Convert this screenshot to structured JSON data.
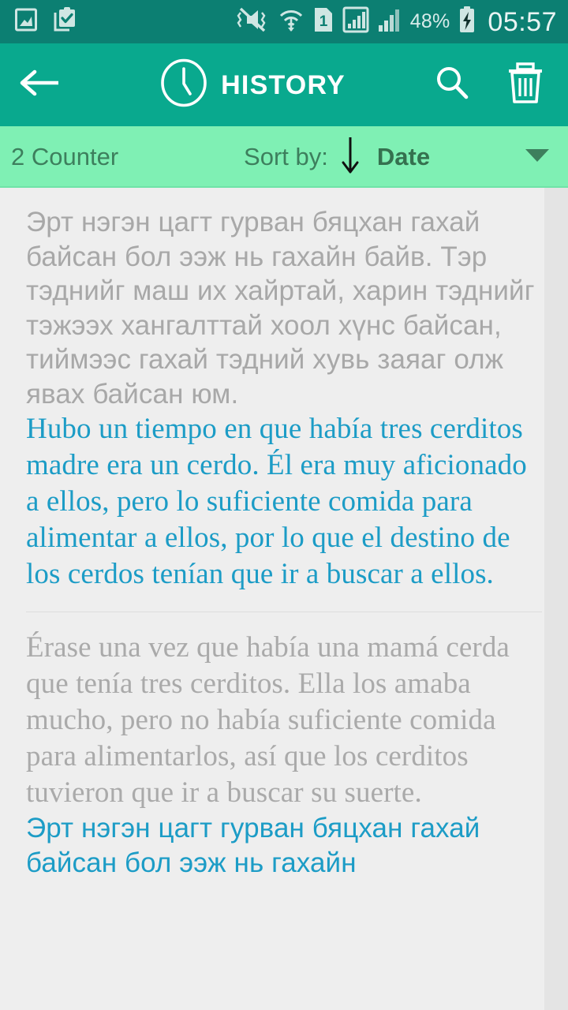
{
  "statusbar": {
    "left_icons": [
      {
        "name": "image-icon"
      },
      {
        "name": "clipboard-check-icon"
      }
    ],
    "right_icons": [
      {
        "name": "mute-vibrate-icon"
      },
      {
        "name": "wifi-icon"
      },
      {
        "name": "sim-card-1-icon"
      },
      {
        "name": "signal-bars-boxed-icon"
      },
      {
        "name": "signal-bars-icon"
      }
    ],
    "battery_percent": "48%",
    "battery_icon": "battery-charging-icon",
    "clock": "05:57"
  },
  "appbar": {
    "back_icon": "back-arrow-icon",
    "clock_icon": "clock-icon",
    "title": "HISTORY",
    "search_icon": "search-icon",
    "delete_icon": "trash-icon"
  },
  "sortbar": {
    "counter": "2 Counter",
    "sort_label": "Sort by:",
    "direction_icon": "arrow-down-icon",
    "sort_value": "Date",
    "dropdown_icon": "chevron-down-icon"
  },
  "list": {
    "items": [
      {
        "source_text": "Эрт нэгэн цагт гурван бяцхан гахай байсан бол ээж нь гахайн байв. Тэр тэднийг маш их хайртай, харин тэднийг тэжээх хангалттай хоол хүнс байсан, тиймээс гахай тэдний хувь заяаг олж явах байсан юм.",
        "source_script": "cyrillic",
        "target_text": "Hubo un tiempo en que había tres cerditos madre era un cerdo. Él era muy aficionado a ellos, pero lo suficiente comida para alimentar a ellos, por lo que el destino de los cerdos tenían que ir a buscar a ellos.",
        "target_script": "latin"
      },
      {
        "source_text": "Érase una vez que había una mamá cerda que tenía tres cerditos. Ella los amaba mucho, pero no había suficiente comida para alimentarlos, así que los cerditos tuvieron que ir a buscar su suerte.",
        "source_script": "latin",
        "target_text": "Эрт нэгэн цагт гурван бяцхан гахай байсан бол ээж нь гахайн",
        "target_script": "cyrillic"
      }
    ]
  },
  "colors": {
    "statusbar_bg": "#0c7f72",
    "appbar_bg": "#09a98e",
    "sortbar_bg": "#7ff0b4",
    "list_bg": "#eeeeee",
    "source_text": "#a8a8a8",
    "target_text": "#1c9cc6",
    "sortbar_text": "#3d7f5d"
  }
}
